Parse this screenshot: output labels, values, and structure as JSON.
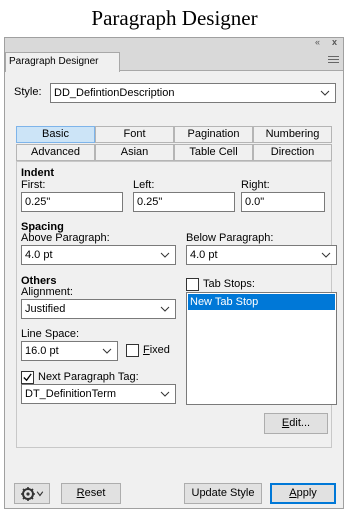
{
  "caption": "Paragraph Designer",
  "panel": {
    "tab_label": "Paragraph Designer",
    "window_controls": [
      "«",
      "x"
    ]
  },
  "style": {
    "label": "Style:",
    "value": "DD_DefintionDescription"
  },
  "tabs": [
    {
      "label": "Basic",
      "active": true
    },
    {
      "label": "Font"
    },
    {
      "label": "Pagination"
    },
    {
      "label": "Numbering"
    },
    {
      "label": "Advanced"
    },
    {
      "label": "Asian"
    },
    {
      "label": "Table Cell"
    },
    {
      "label": "Direction"
    }
  ],
  "indent": {
    "heading": "Indent",
    "first_label": "First:",
    "first_value": "0.25\"",
    "left_label": "Left:",
    "left_value": "0.25\"",
    "right_label": "Right:",
    "right_value": "0.0\""
  },
  "spacing": {
    "heading": "Spacing",
    "above_label": "Above Paragraph:",
    "above_value": "4.0 pt",
    "below_label": "Below Paragraph:",
    "below_value": "4.0 pt"
  },
  "others": {
    "heading": "Others",
    "alignment_label": "Alignment:",
    "alignment_value": "Justified",
    "line_space_label": "Line Space:",
    "line_space_value": "16.0 pt",
    "fixed_label": "Fixed",
    "fixed_checked": false,
    "next_tag_label": "Next Paragraph Tag:",
    "next_tag_checked": true,
    "next_tag_value": "DT_DefinitionTerm"
  },
  "tab_stops": {
    "label": "Tab Stops:",
    "checked": false,
    "items": [
      "New Tab Stop"
    ],
    "edit_label": "Edit..."
  },
  "footer": {
    "reset_label": "Reset",
    "update_label": "Update Style",
    "apply_label": "Apply"
  },
  "colors": {
    "accent": "#0078d7",
    "active_tab": "#cce4f7"
  }
}
